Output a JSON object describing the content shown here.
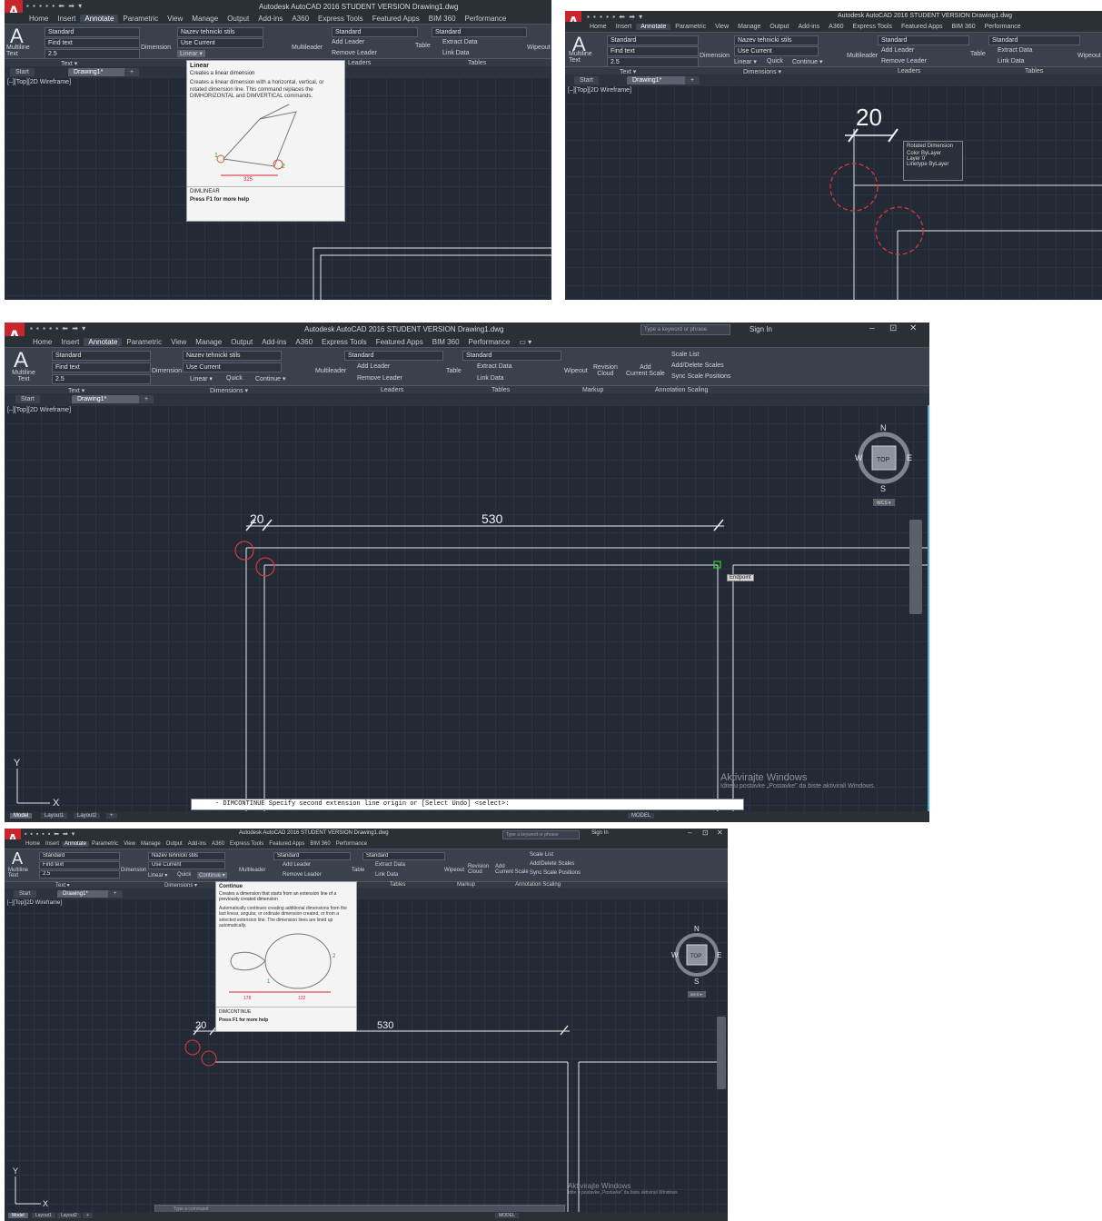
{
  "app": {
    "title": "Autodesk AutoCAD 2016   STUDENT VERSION   Drawing1.dwg",
    "logo": "A",
    "qat": "▪ ▪ ▪ ▪ ▪ ⬅ ➡ ▾",
    "search_placeholder": "Type a keyword or phrase",
    "sign_in": "Sign In",
    "window_buttons": [
      "–",
      "⊡",
      "✕"
    ]
  },
  "menu_tabs": [
    "Home",
    "Insert",
    "Annotate",
    "Parametric",
    "View",
    "Manage",
    "Output",
    "Add-ins",
    "A360",
    "Express Tools",
    "Featured Apps",
    "BIM 360",
    "Performance",
    "▭ ▾"
  ],
  "active_tab": "Annotate",
  "ribbon": {
    "multiline_text": "Multiline\nText",
    "text_style": "Standard",
    "find_text": "Find text",
    "text_height": "2.5",
    "dimension": "Dimension",
    "dim_style": "Nazev tehnicki stils",
    "use_current": "Use Current",
    "linear": "Linear ▾",
    "quick": "Quick",
    "continue": "Continue ▾",
    "multileader": "Multileader",
    "leader_style": "Standard",
    "add_leader": "Add Leader",
    "remove_leader": "Remove Leader",
    "table_style": "Standard",
    "table": "Table",
    "extract_data": "Extract Data",
    "link_data": "Link Data",
    "wipeout": "Wipeout",
    "revision_cloud": "Revision\nCloud",
    "add_current_scale": "Add\nCurrent Scale",
    "scale_list": "Scale List",
    "add_delete_scales": "Add/Delete Scales",
    "sync_scale": "Sync Scale Positions"
  },
  "panels": [
    "Text ▾",
    "Dimensions ▾",
    "Leaders",
    "Tables",
    "Markup",
    "Annotation Scaling"
  ],
  "file_tabs": [
    "Start",
    "Drawing1*",
    "+"
  ],
  "viewport_label": "[–][Top][2D Wireframe]",
  "tooltip_linear": {
    "title": "Linear",
    "subtitle": "Creates a linear dimension",
    "body": "Creates a linear dimension with a horizontal, vertical, or rotated dimension line. This command replaces the DIMHORIZONTAL and DIMVERTICAL commands.",
    "command": "DIMLINEAR",
    "help": "Press F1 for more help",
    "marker_1": "1",
    "marker_2": "2",
    "dim_text": "325"
  },
  "tooltip_continue": {
    "title": "Continue",
    "subtitle": "Creates a dimension that starts from an extension line of a previously created dimension",
    "body": "Automatically continues creating additional dimensions from the last linear, angular, or ordinate dimension created, or from a selected extension line. The dimension lines are lined up automatically.",
    "command": "DIMCONTINUE",
    "help": "Press F1 for more help",
    "marker_1": "1",
    "marker_2": "2",
    "dim_left": "178",
    "dim_right": "122"
  },
  "rotated_dimension": {
    "title": "Rotated Dimension",
    "rows": [
      [
        "Color",
        "ByLayer"
      ],
      [
        "Layer",
        "0"
      ],
      [
        "Linetype",
        "ByLayer"
      ]
    ]
  },
  "dimensions": {
    "first": "20",
    "second": "530"
  },
  "compass": {
    "n": "N",
    "s": "S",
    "e": "E",
    "w": "W",
    "top": "TOP",
    "wcs": "WCS ▾"
  },
  "snap_tip": "Endpoint",
  "ucs": {
    "x": "X",
    "y": "Y"
  },
  "command_line": {
    "prompt": "- DIMCONTINUE Specify second extension line origin or [Select Undo] <select>:",
    "placeholder": "Type a command"
  },
  "layout_tabs": [
    "Model",
    "Layout1",
    "Layout2",
    "+"
  ],
  "status": {
    "model": "MODEL"
  },
  "watermark": {
    "title": "Aktivirajte Windows",
    "subtitle": "Idite u postavke „Postavke\" da biste aktivirali Windows."
  },
  "colors": {
    "accent_red": "#c8252d",
    "canvas_bg": "#232a36",
    "snap_marker": "#d63a3a",
    "endpoint_marker": "#2fcf2f"
  }
}
